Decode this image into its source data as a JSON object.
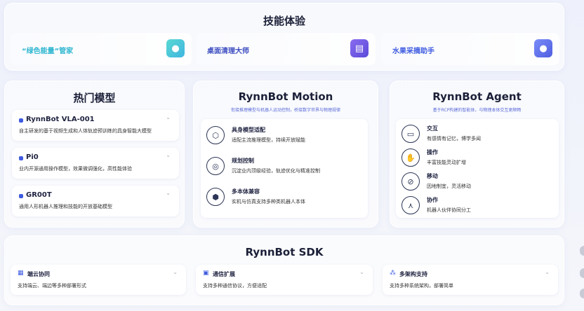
{
  "skills": {
    "title": "技能体验",
    "items": [
      {
        "label": "“绿色能量”管家",
        "icon": "cluster-icon",
        "color": "#2fc3d8",
        "iconColor": "#4fd3d8"
      },
      {
        "label": "桌面清理大师",
        "icon": "document-icon",
        "color": "#3b4cc0",
        "iconColor": "#6a4fe0"
      },
      {
        "label": "水果采摘助手",
        "icon": "cluster-icon",
        "color": "#3f5be0",
        "iconColor": "#5b6cf0"
      }
    ]
  },
  "hot_models": {
    "title": "热门模型",
    "items": [
      {
        "name": "RynnBot VLA-001",
        "desc": "自主研发的基于视频生成和人体轨迹预训练的具身智能大模型"
      },
      {
        "name": "Pi0",
        "desc": "业内开源通用操作模型，效果微调强化，高性能体验"
      },
      {
        "name": "GR00T",
        "desc": "通用人形机器人推理和技能的开放基础模型"
      }
    ]
  },
  "motion": {
    "title": "RynnBot Motion",
    "subtitle": "衔接推理模型与机器人运动控制，桥接数字世界与物理规律",
    "features": [
      {
        "title": "具身模型适配",
        "desc": "适配主流推理模型，持续开放赋能",
        "icon": "cube-icon",
        "glyph": "⬡"
      },
      {
        "title": "规划控制",
        "desc": "沉淀业内顶级经验，轨迹优化与精准控制",
        "icon": "target-icon",
        "glyph": "◎"
      },
      {
        "title": "多本体兼容",
        "desc": "实机与仿真支持多种类机器人本体",
        "icon": "layers-icon",
        "glyph": "⬢"
      }
    ]
  },
  "agent": {
    "title": "RynnBot Agent",
    "subtitle": "基于RCP构建的智能体，与物理本体交互更顺畅",
    "features": [
      {
        "title": "交互",
        "desc": "有感情有记忆，博学多闻",
        "icon": "monitor-icon",
        "glyph": "▭"
      },
      {
        "title": "操作",
        "desc": "丰富技能灵动扩增",
        "icon": "hand-icon",
        "glyph": "✋"
      },
      {
        "title": "移动",
        "desc": "因地制宜，灵活移动",
        "icon": "compass-icon",
        "glyph": "⊘"
      },
      {
        "title": "协作",
        "desc": "机器人伙伴协同分工",
        "icon": "network-icon",
        "glyph": "⋏"
      }
    ]
  },
  "sdk": {
    "title": "RynnBot SDK",
    "items": [
      {
        "title": "端云协同",
        "desc": "支持端云、端边等多种部署形式",
        "icon": "grid-icon",
        "glyph": "▦"
      },
      {
        "title": "通信扩展",
        "desc": "支持多种通信协议，方便适配",
        "icon": "plug-icon",
        "glyph": "▣"
      },
      {
        "title": "多架构支持",
        "desc": "支持多种系统架构，部署简单",
        "icon": "nodes-icon",
        "glyph": "⁂"
      }
    ]
  }
}
